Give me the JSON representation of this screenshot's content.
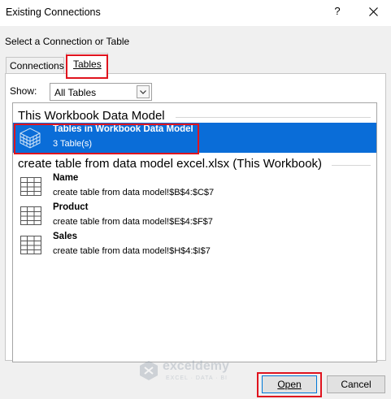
{
  "window": {
    "title": "Existing Connections",
    "help_label": "?"
  },
  "dialog": {
    "subtitle": "Select a Connection or Table",
    "tabs": [
      {
        "label": "Connections",
        "selected": false
      },
      {
        "label": "Tables",
        "selected": true
      }
    ],
    "show_label": "Show:",
    "show_select": {
      "value": "All Tables"
    }
  },
  "list": {
    "groups": [
      {
        "header": "This Workbook Data Model",
        "items": [
          {
            "title": "Tables in Workbook Data Model",
            "subtitle": "3 Table(s)",
            "selected": true
          }
        ]
      },
      {
        "header": "create table from data model excel.xlsx (This Workbook)",
        "items": [
          {
            "title": "Name",
            "subtitle": "create table from data model!$B$4:$C$7"
          },
          {
            "title": "Product",
            "subtitle": "create table from data model!$E$4:$F$7"
          },
          {
            "title": "Sales",
            "subtitle": "create table from data model!$H$4:$I$7"
          }
        ]
      }
    ]
  },
  "watermark": {
    "brand": "exceldemy",
    "tagline": "EXCEL · DATA · BI"
  },
  "buttons": {
    "open": "Open",
    "cancel": "Cancel"
  },
  "colors": {
    "selection": "#0a6dd8",
    "highlight_box": "#e0141e",
    "dialog_bg": "#f0f0f0"
  }
}
